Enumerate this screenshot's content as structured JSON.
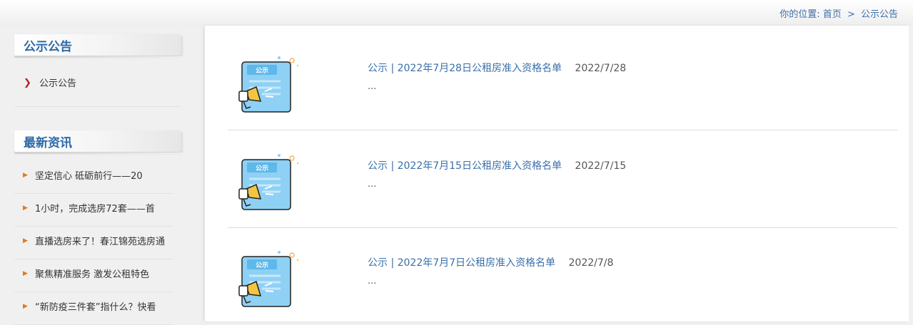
{
  "breadcrumb": {
    "prefix": "你的位置:",
    "home": "首页",
    "separator": ">",
    "current": "公示公告"
  },
  "sidebar": {
    "category_heading": "公示公告",
    "categories": [
      {
        "label": "公示公告"
      }
    ],
    "news_heading": "最新资讯",
    "news": [
      {
        "label": "坚定信心  砥砺前行——20"
      },
      {
        "label": "1小时，完成选房72套——首"
      },
      {
        "label": "直播选房来了！春江锦苑选房通"
      },
      {
        "label": "聚焦精准服务 激发公租特色"
      },
      {
        "label": "“新防疫三件套”指什么？快看"
      }
    ]
  },
  "main": {
    "entries": [
      {
        "title": "公示 | 2022年7月28日公租房准入资格名单",
        "date": "2022/7/28",
        "excerpt": "...",
        "thumb_label": "公示"
      },
      {
        "title": "公示 | 2022年7月15日公租房准入资格名单",
        "date": "2022/7/15",
        "excerpt": "...",
        "thumb_label": "公示"
      },
      {
        "title": "公示 | 2022年7月7日公租房准入资格名单",
        "date": "2022/7/8",
        "excerpt": "...",
        "thumb_label": "公示"
      }
    ]
  },
  "icons": {
    "category_bullet": "chevron-right-icon",
    "news_bullet": "bullet-icon",
    "thumbnail": "announcement-megaphone-icon"
  },
  "colors": {
    "link": "#3a6fa8",
    "heading": "#2d6aa8",
    "chevron": "#b22222",
    "bullet": "#e07a1a",
    "thumb_board": "#8fd0f5",
    "megaphone": "#f5c542"
  }
}
